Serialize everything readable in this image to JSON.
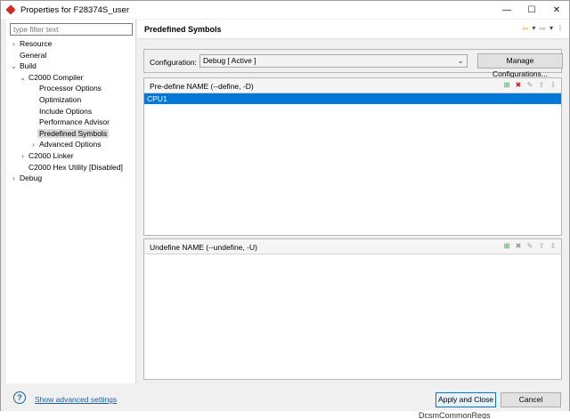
{
  "window": {
    "title": "Properties for F28374S_user",
    "minimize": "—",
    "maximize": "☐",
    "close": "✕"
  },
  "filter": {
    "placeholder": "type filter text"
  },
  "tree": [
    {
      "label": "Resource",
      "arrow": "›",
      "level": 0
    },
    {
      "label": "General",
      "arrow": "",
      "level": 0
    },
    {
      "label": "Build",
      "arrow": "⌄",
      "level": 0
    },
    {
      "label": "C2000 Compiler",
      "arrow": "⌄",
      "level": 1
    },
    {
      "label": "Processor Options",
      "arrow": "",
      "level": 2
    },
    {
      "label": "Optimization",
      "arrow": "",
      "level": 2
    },
    {
      "label": "Include Options",
      "arrow": "",
      "level": 2
    },
    {
      "label": "Performance Advisor",
      "arrow": "",
      "level": 2
    },
    {
      "label": "Predefined Symbols",
      "arrow": "",
      "level": 2,
      "selected": true
    },
    {
      "label": "Advanced Options",
      "arrow": "›",
      "level": 2
    },
    {
      "label": "C2000 Linker",
      "arrow": "›",
      "level": 1
    },
    {
      "label": "C2000 Hex Utility  [Disabled]",
      "arrow": "",
      "level": 1
    },
    {
      "label": "Debug",
      "arrow": "›",
      "level": 0
    }
  ],
  "page": {
    "title": "Predefined Symbols",
    "nav": {
      "back": "⇦",
      "back_menu": "▾",
      "forward": "⇨",
      "forward_menu": "▾",
      "menu": "⋮"
    }
  },
  "configuration": {
    "label": "Configuration:",
    "value": "Debug  [ Active ]",
    "manage_label": "Manage Configurations..."
  },
  "predefine": {
    "title": "Pre-define NAME (--define, -D)",
    "items": [
      "CPU1"
    ]
  },
  "undefine": {
    "title": "Undefine NAME (--undefine, -U)",
    "items": []
  },
  "footer": {
    "help": "?",
    "advanced_link": "Show advanced settings",
    "apply_label": "Apply and Close",
    "cancel_label": "Cancel"
  },
  "background": {
    "peek_text": "DcsmCommonRegs"
  }
}
